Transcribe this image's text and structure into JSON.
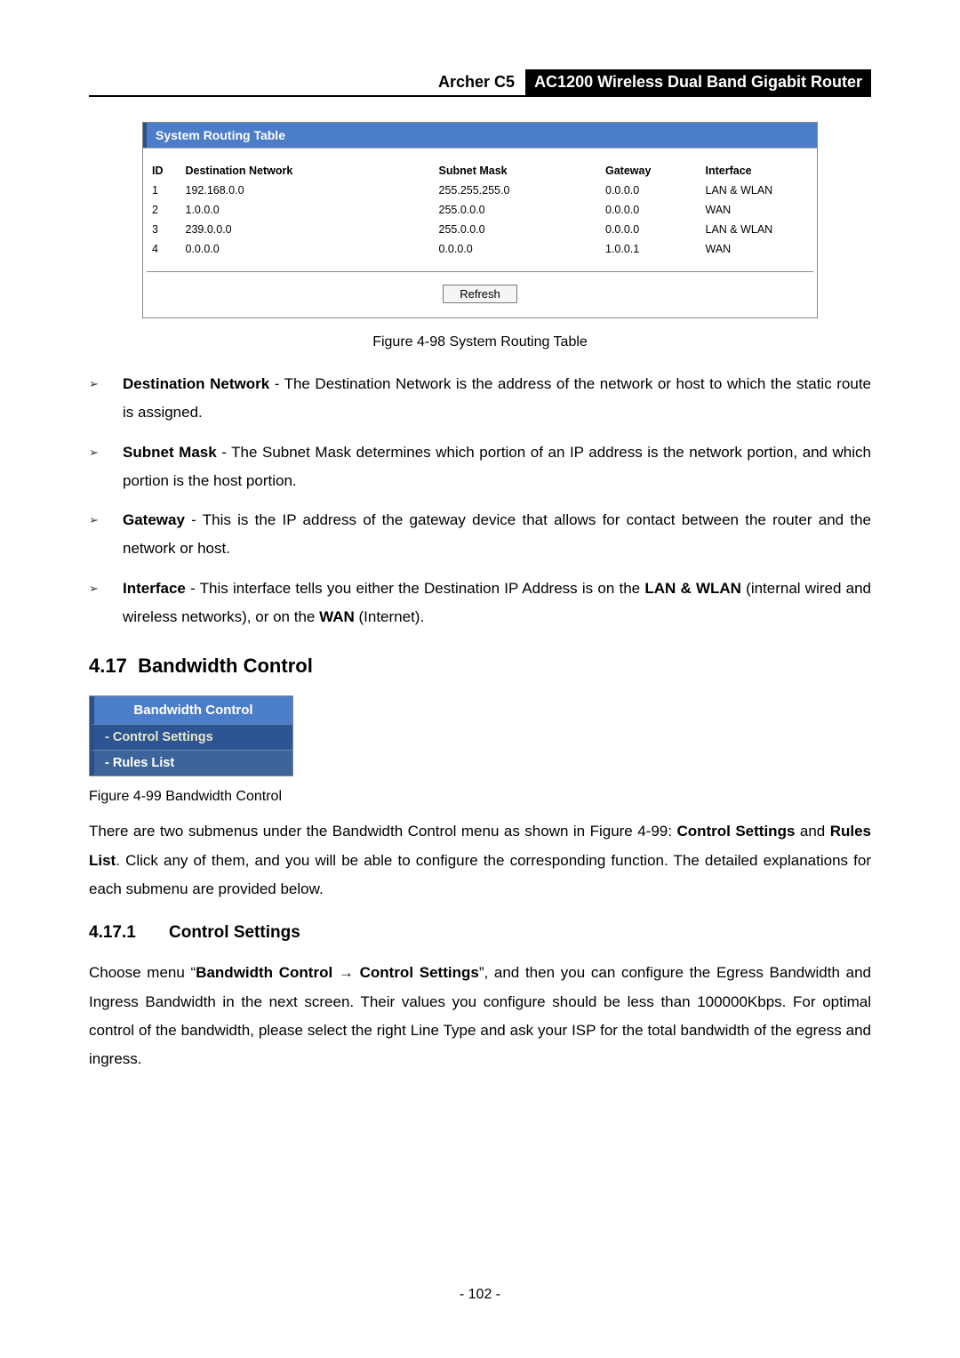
{
  "header": {
    "model": "Archer C5",
    "desc": "AC1200 Wireless Dual Band Gigabit Router"
  },
  "routing_table": {
    "title": "System Routing Table",
    "columns": {
      "id": "ID",
      "dest": "Destination Network",
      "mask": "Subnet Mask",
      "gw": "Gateway",
      "if": "Interface"
    },
    "rows": [
      {
        "id": "1",
        "dest": "192.168.0.0",
        "mask": "255.255.255.0",
        "gw": "0.0.0.0",
        "if": "LAN & WLAN"
      },
      {
        "id": "2",
        "dest": "1.0.0.0",
        "mask": "255.0.0.0",
        "gw": "0.0.0.0",
        "if": "WAN"
      },
      {
        "id": "3",
        "dest": "239.0.0.0",
        "mask": "255.0.0.0",
        "gw": "0.0.0.0",
        "if": "LAN & WLAN"
      },
      {
        "id": "4",
        "dest": "0.0.0.0",
        "mask": "0.0.0.0",
        "gw": "1.0.0.1",
        "if": "WAN"
      }
    ],
    "refresh": "Refresh"
  },
  "fig1": "Figure 4-98 System Routing Table",
  "bullets": [
    {
      "term": "Destination Network",
      "rest": " - The Destination Network is the address of the network or host to which the static route is assigned."
    },
    {
      "term": "Subnet Mask",
      "rest": " - The Subnet Mask determines which portion of an IP address is the network portion, and which portion is the host portion."
    },
    {
      "term": "Gateway",
      "rest": " - This is the IP address of the gateway device that allows for contact between the router and the network or host."
    }
  ],
  "bullet4": {
    "term": "Interface",
    "p1": " - This interface tells you either the Destination IP Address is on the ",
    "b1": "LAN & WLAN",
    "p2": " (internal wired and wireless networks), or on the ",
    "b2": "WAN",
    "p3": " (Internet)."
  },
  "section": {
    "num": "4.17",
    "title": "Bandwidth Control"
  },
  "nav": {
    "header": "Bandwidth Control",
    "item1": "- Control Settings",
    "item2": "- Rules List"
  },
  "fig2": "Figure 4-99 Bandwidth Control",
  "intro": {
    "p1": "There are two submenus under the Bandwidth Control menu as shown in Figure 4-99: ",
    "b1": "Control Settings",
    "p2": " and ",
    "b2": "Rules List",
    "p3": ". Click any of them, and you will be able to configure the corresponding function. The detailed explanations for each submenu are provided below."
  },
  "subsection": {
    "num": "4.17.1",
    "title": "Control Settings"
  },
  "choose": {
    "p1": "Choose menu “",
    "b1": "Bandwidth Control",
    "arrow": " → ",
    "b2": "Control Settings",
    "p2": "”, and then you can configure the Egress Bandwidth and Ingress Bandwidth in the next screen. Their values you configure should be less than 100000Kbps. For optimal control of the bandwidth, please select the right Line Type and ask your ISP for the total bandwidth of the egress and ingress."
  },
  "page_num": "- 102 -",
  "marker": "➢"
}
